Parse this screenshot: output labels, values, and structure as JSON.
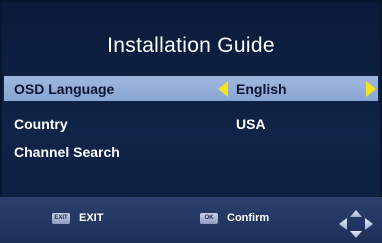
{
  "title": "Installation Guide",
  "menu": [
    {
      "label": "OSD Language",
      "value": "English"
    },
    {
      "label": "Country",
      "value": "USA"
    },
    {
      "label": "Channel Search",
      "value": ""
    }
  ],
  "footer": {
    "exit_badge": "EXIT",
    "exit_label": "EXIT",
    "ok_badge": "OK",
    "confirm_label": "Confirm"
  },
  "icons": {
    "value_left": "arrow-left-icon",
    "value_right": "arrow-right-icon",
    "navigation": "dpad-icon"
  },
  "colors": {
    "background": "#0d1e3e",
    "highlight": "#93acd8",
    "arrow": "#f4e21c"
  }
}
